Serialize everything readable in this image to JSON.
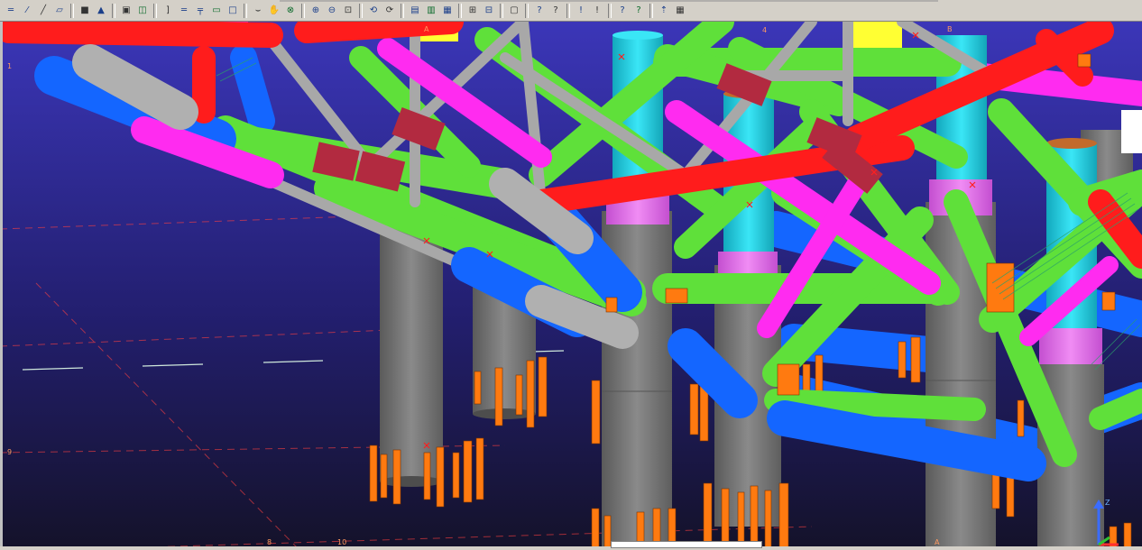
{
  "toolbar": {
    "groups": [
      {
        "icons": [
          "beam-icon",
          "column-icon",
          "brace-icon",
          "plate-icon"
        ]
      },
      {
        "icons": [
          "bolt-icon",
          "weld-icon"
        ]
      },
      {
        "icons": [
          "part-icon",
          "assembly-icon"
        ]
      },
      {
        "icons": [
          "profile-icon",
          "flat-icon",
          "angle-icon",
          "channel-icon",
          "rectangle-icon"
        ]
      },
      {
        "icons": [
          "pad-icon",
          "component-icon",
          "detail-icon"
        ]
      },
      {
        "icons": [
          "zoom-in-icon",
          "zoom-out-icon",
          "zoom-window-icon"
        ]
      },
      {
        "icons": [
          "rotate-icon",
          "pan-icon"
        ]
      },
      {
        "icons": [
          "view-1-icon",
          "view-2-icon",
          "view-3-icon"
        ]
      },
      {
        "icons": [
          "render-icon",
          "clip-icon"
        ]
      },
      {
        "icons": [
          "window-icon"
        ]
      },
      {
        "icons": [
          "inquire-icon",
          "measure-icon"
        ]
      },
      {
        "icons": [
          "report-icon",
          "numbering-icon"
        ]
      },
      {
        "icons": [
          "select-icon",
          "snap-icon"
        ]
      },
      {
        "icons": [
          "help-icon",
          "info-icon"
        ]
      }
    ],
    "glyphs": [
      "═",
      "⁄",
      "╱",
      "▱",
      "■",
      "▲",
      "▣",
      "◫",
      "]",
      "═",
      "╤",
      "▭",
      "□",
      "⌣",
      "✋",
      "⊗",
      "⊕",
      "⊖",
      "⊡",
      "⟲",
      "⟳",
      "▤",
      "▥",
      "▦",
      "⊞",
      "⊟",
      "▢",
      "?",
      "?",
      "!",
      "!",
      "?",
      "?",
      "⇡",
      "▦"
    ]
  },
  "viewport": {
    "grid_labels": [
      "A",
      "B",
      "4",
      "1",
      "9",
      "8",
      "10",
      "A"
    ],
    "axis_labels": [
      "Z"
    ],
    "colors": {
      "background_top": "#3b36b8",
      "background_bottom": "#14122a",
      "column": "#7a7a7a",
      "brace_green": "#5fe03a",
      "brace_magenta": "#ff2bf0",
      "beam_red": "#ff1c1c",
      "leg_cyan": "#1fd0e6",
      "leg_blue": "#1466ff",
      "pile_orange": "#ff7a10",
      "node_darkred": "#b22a40",
      "top_yellow": "#ffff33"
    }
  }
}
